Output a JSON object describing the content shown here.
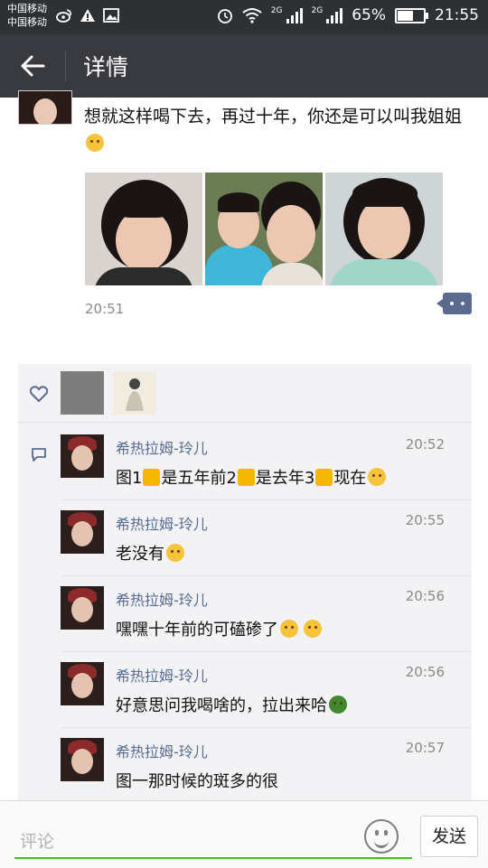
{
  "status_bar": {
    "carrier_1": "中国移动",
    "carrier_2": "中国移动",
    "network_1": "2G",
    "network_2": "2G",
    "battery": "65%",
    "battery_level": 0.65,
    "time": "21:55"
  },
  "header": {
    "title": "详情"
  },
  "post": {
    "text": "想就这样喝下去，再过十年，你还是可以叫我姐姐",
    "time": "20:51"
  },
  "comments": [
    {
      "name": "希热拉姆-玲儿",
      "time": "20:52",
      "parts": [
        "图1",
        "是五年前2",
        "是去年3",
        "现在"
      ]
    },
    {
      "name": "希热拉姆-玲儿",
      "time": "20:55",
      "text": "老没有"
    },
    {
      "name": "希热拉姆-玲儿",
      "time": "20:56",
      "text": "嘿嘿十年前的可磕碜了"
    },
    {
      "name": "希热拉姆-玲儿",
      "time": "20:56",
      "text": "好意思问我喝啥的，拉出来哈"
    },
    {
      "name": "希热拉姆-玲儿",
      "time": "20:57",
      "text": "图一那时候的斑多的很"
    }
  ],
  "bottom_bar": {
    "placeholder": "评论",
    "send_label": "发送"
  },
  "icons": [
    "weibo-icon",
    "alert-icon",
    "image-icon",
    "alarm-icon",
    "wifi-icon",
    "signal-icon",
    "battery-icon",
    "back-arrow-icon",
    "more-icon",
    "heart-icon",
    "comment-icon",
    "emoji-icon"
  ],
  "colors": {
    "status_bar": "#2e3134",
    "title_bar": "#393a3f",
    "name": "#576b95",
    "accent": "#45c01a"
  }
}
